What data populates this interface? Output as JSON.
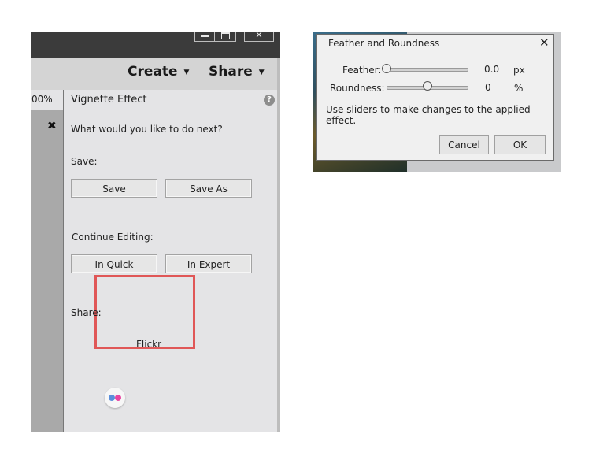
{
  "app": {
    "window_buttons": {
      "close_glyph": "✕"
    },
    "menu": {
      "create": "Create",
      "share": "Share",
      "caret": "▼"
    },
    "zoom_fragment": "00%",
    "strip_close": "✖",
    "panel": {
      "title": "Vignette Effect",
      "help": "?",
      "prompt": "What would you like to do next?",
      "save_label": "Save:",
      "save_button": "Save",
      "save_as_button": "Save As",
      "continue_label": "Continue Editing:",
      "in_quick_button": "In Quick",
      "in_expert_button": "In Expert",
      "share_label": "Share:",
      "flickr_label": "Flickr"
    },
    "colors": {
      "highlight": "#e05757",
      "flickr_blue": "#5b8fdc",
      "flickr_pink": "#e846a2"
    }
  },
  "dialog": {
    "title": "Feather and Roundness",
    "close": "✕",
    "feather": {
      "label": "Feather:",
      "value": "0.0",
      "unit": "px",
      "slider_fraction": 0.0
    },
    "roundness": {
      "label": "Roundness:",
      "value": "0",
      "unit": "%",
      "slider_fraction": 0.5
    },
    "message": "Use sliders to make changes to the applied effect.",
    "cancel": "Cancel",
    "ok": "OK"
  }
}
